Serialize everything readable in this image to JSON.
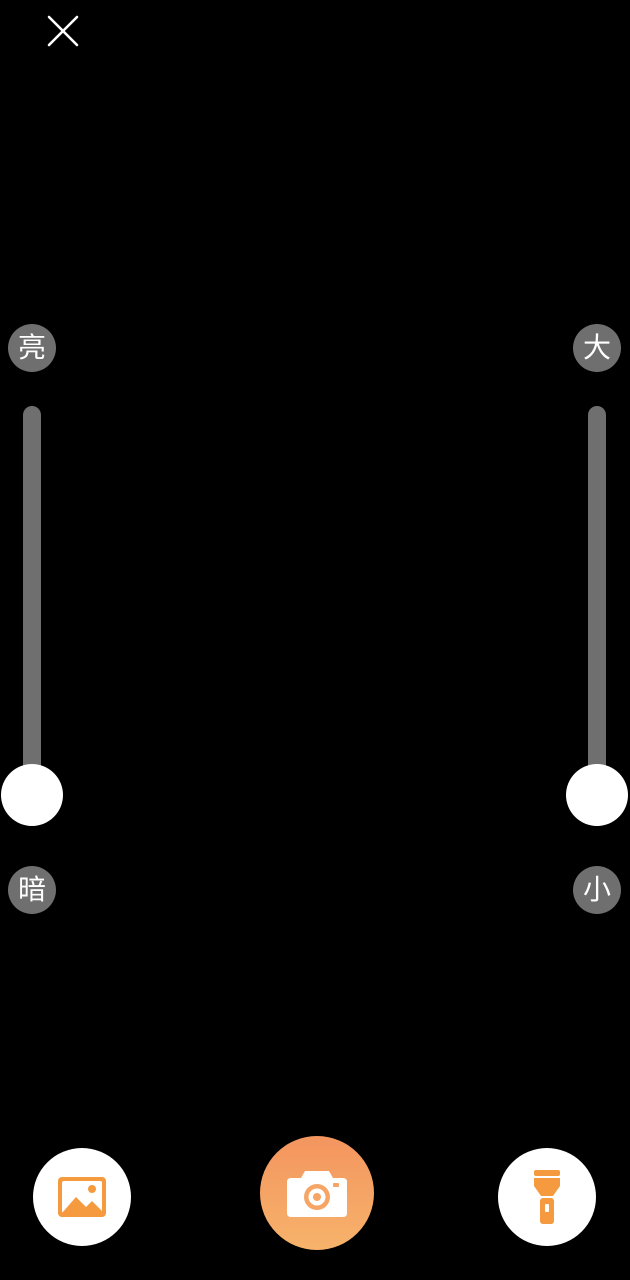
{
  "brightness": {
    "max_label": "亮",
    "min_label": "暗",
    "value": 0
  },
  "zoom": {
    "max_label": "大",
    "min_label": "小",
    "value": 0
  },
  "icons": {
    "close": "close-icon",
    "gallery": "image-icon",
    "capture": "camera-icon",
    "flashlight": "flashlight-icon"
  },
  "colors": {
    "background": "#000000",
    "slider_track": "#6f6f6f",
    "accent_orange": "#f5a262",
    "icon_orange": "#f59a3e"
  }
}
